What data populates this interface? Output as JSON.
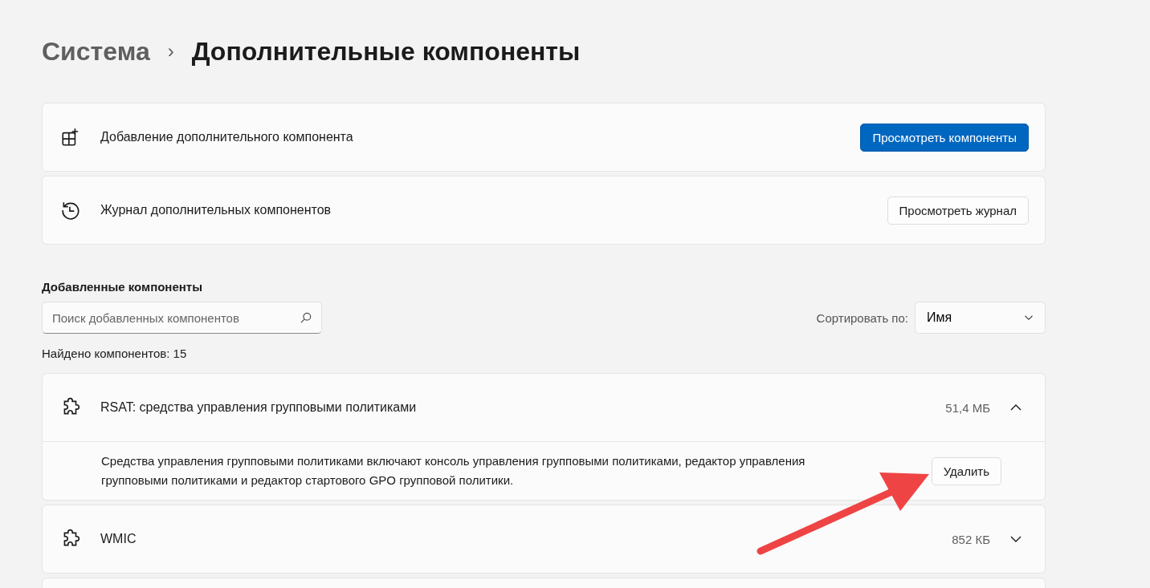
{
  "breadcrumb": {
    "parent": "Система",
    "separator": "›",
    "current": "Дополнительные компоненты"
  },
  "actions": [
    {
      "kind": "add",
      "label": "Добавление дополнительного компонента",
      "button": "Просмотреть компоненты",
      "primary": true
    },
    {
      "kind": "history",
      "label": "Журнал дополнительных компонентов",
      "button": "Просмотреть журнал",
      "primary": false
    }
  ],
  "installed": {
    "title": "Добавленные компоненты",
    "search": {
      "placeholder": "Поиск добавленных компонентов"
    },
    "sort": {
      "label": "Сортировать по:",
      "value": "Имя"
    },
    "count": "Найдено компонентов: 15",
    "items": [
      {
        "name": "RSAT: средства управления групповыми политиками",
        "size": "51,4 МБ",
        "expanded": true,
        "description": "Средства управления групповыми политиками включают консоль управления групповыми политиками, редактор управления групповыми политиками и редактор стартового GPO групповой политики.",
        "button": "Удалить"
      },
      {
        "name": "WMIC",
        "size": "852 КБ",
        "expanded": false
      }
    ]
  }
}
